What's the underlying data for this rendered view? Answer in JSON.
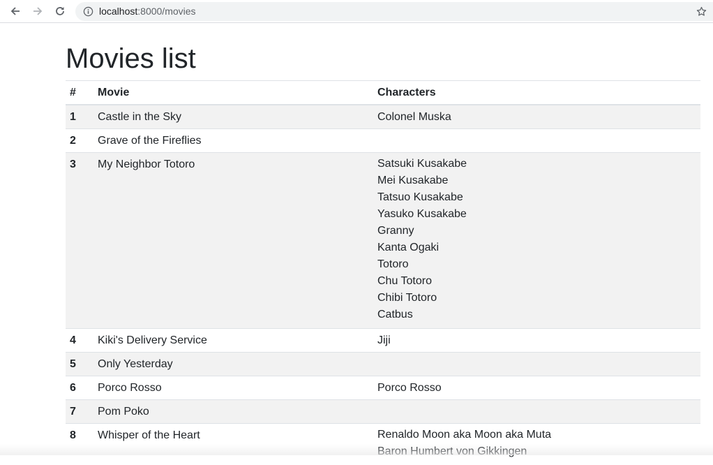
{
  "browser": {
    "url_host": "localhost",
    "url_rest": ":8000/movies"
  },
  "page": {
    "title": "Movies list"
  },
  "table": {
    "headers": [
      "#",
      "Movie",
      "Characters"
    ],
    "rows": [
      {
        "num": "1",
        "movie": "Castle in the Sky",
        "characters": [
          "Colonel Muska"
        ]
      },
      {
        "num": "2",
        "movie": "Grave of the Fireflies",
        "characters": []
      },
      {
        "num": "3",
        "movie": "My Neighbor Totoro",
        "characters": [
          "Satsuki Kusakabe",
          "Mei Kusakabe",
          "Tatsuo Kusakabe",
          "Yasuko Kusakabe",
          "Granny",
          "Kanta Ogaki",
          "Totoro",
          "Chu Totoro",
          "Chibi Totoro",
          "Catbus"
        ]
      },
      {
        "num": "4",
        "movie": "Kiki's Delivery Service",
        "characters": [
          "Jiji"
        ]
      },
      {
        "num": "5",
        "movie": "Only Yesterday",
        "characters": []
      },
      {
        "num": "6",
        "movie": "Porco Rosso",
        "characters": [
          "Porco Rosso"
        ]
      },
      {
        "num": "7",
        "movie": "Pom Poko",
        "characters": []
      },
      {
        "num": "8",
        "movie": "Whisper of the Heart",
        "characters": [
          "Renaldo Moon aka Moon aka Muta",
          "Baron Humbert von Gikkingen"
        ]
      }
    ]
  }
}
